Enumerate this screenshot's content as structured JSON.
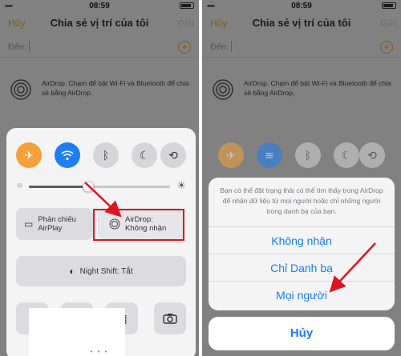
{
  "status_bar": {
    "signal": "•••••",
    "time": "08:59"
  },
  "nav": {
    "cancel_label": "Hủy",
    "title": "Chia sẻ vị trí của tôi",
    "send_label": "Gửi"
  },
  "to_field": {
    "label": "Đến:"
  },
  "airdrop_info": {
    "text": "AirDrop. Chạm để bật Wi-Fi và Bluetooth để chia sẻ bằng AirDrop."
  },
  "control_center": {
    "toggles": [
      {
        "name": "airplane",
        "icon": "airplane-icon",
        "glyph": "✈",
        "state": "on",
        "color": "#f6a03a"
      },
      {
        "name": "wifi",
        "icon": "wifi-icon",
        "glyph": "⌔",
        "state": "on",
        "color": "#1e7ff2"
      },
      {
        "name": "bluetooth",
        "icon": "bluetooth-icon",
        "glyph": "ᛒ",
        "state": "off"
      },
      {
        "name": "do-not-disturb",
        "icon": "moon-icon",
        "glyph": "☾",
        "state": "off"
      },
      {
        "name": "rotation-lock",
        "icon": "rotation-lock-icon",
        "glyph": "⟲",
        "state": "off"
      }
    ],
    "brightness_level": 0.42,
    "airplay_label_1": "Phản chiếu",
    "airplay_label_2": "AirPlay",
    "airdrop_label_1": "AirDrop:",
    "airdrop_label_2": "Không nhận",
    "night_shift_label": "Night Shift: Tắt"
  },
  "sheet": {
    "message": "Bạn có thể đặt trạng thái có thể tìm thấy trong AirDrop để nhận dữ liệu từ mọi người hoặc chỉ những người trong danh bạ của bạn.",
    "options": [
      "Không nhận",
      "Chỉ Danh bạ",
      "Mọi người"
    ],
    "cancel_label": "Hủy"
  },
  "colors": {
    "accent": "#e8a03a",
    "ios_blue": "#1a7df0",
    "highlight_red": "#e0141e"
  }
}
